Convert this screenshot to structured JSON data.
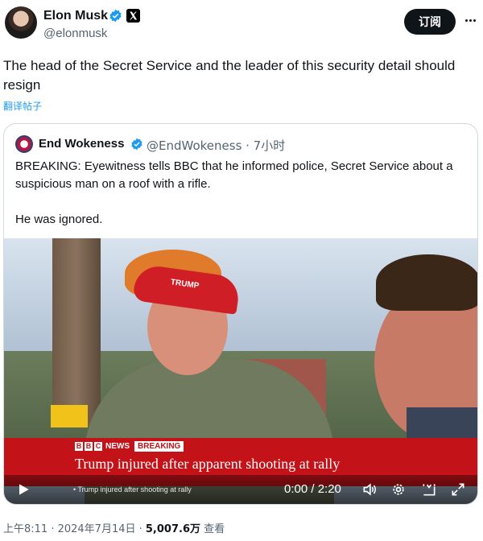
{
  "author": {
    "name": "Elon Musk",
    "handle": "@elonmusk",
    "follow_label": "订阅"
  },
  "tweet": {
    "text": "The head of the Secret Service and the leader of this security detail should resign",
    "translate_label": "翻译帖子"
  },
  "quote": {
    "name": "End Wokeness",
    "handle_time": "@EndWokeness · 7小时",
    "text": "BREAKING: Eyewitness tells BBC that he informed police, Secret Service about a suspicious man on a roof with a rifle.\n\nHe was ignored.",
    "video": {
      "bbc_letters": [
        "B",
        "B",
        "C"
      ],
      "news_label": "NEWS",
      "breaking_label": "BREAKING",
      "headline": "Trump injured after apparent shooting at rally",
      "ticker": "• Trump injured after shooting at rally",
      "time": "0:00 / 2:20",
      "cap_text": "TRUMP"
    }
  },
  "meta": {
    "timestamp": "上午8:11 · 2024年7月14日 · ",
    "views": "5,007.6万",
    "views_label": " 查看"
  },
  "colors": {
    "accent": "#1d9bf0",
    "bbc_red": "#c41219",
    "text": "#0f1419",
    "muted": "#536471"
  },
  "icons": [
    "verified-badge-icon",
    "x-logo-icon",
    "more-options-icon",
    "play-icon",
    "volume-icon",
    "settings-icon",
    "theater-mode-icon",
    "fullscreen-icon"
  ]
}
